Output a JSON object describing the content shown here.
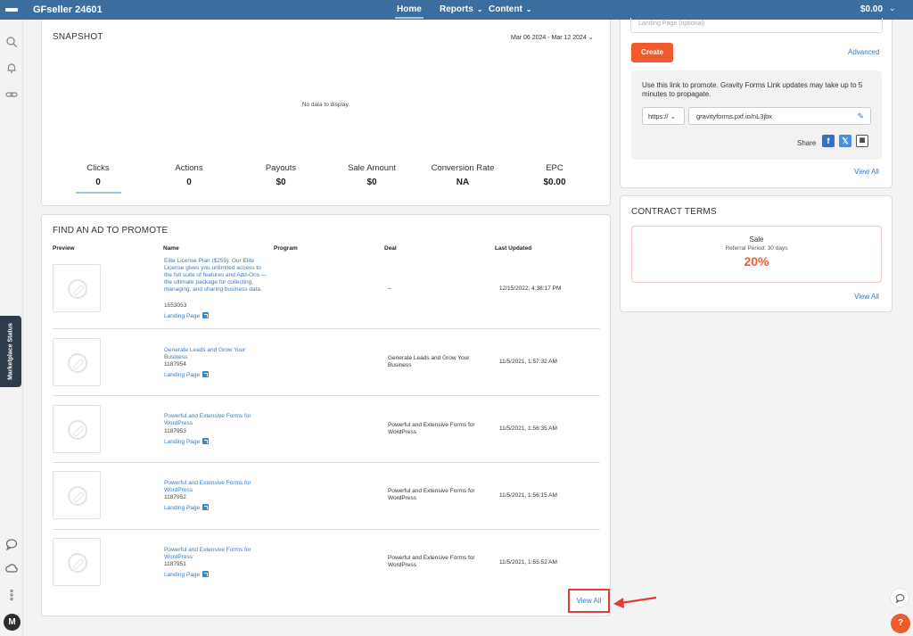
{
  "topbar": {
    "brand": "GFseller 24601",
    "nav": [
      {
        "label": "Home",
        "chev": ""
      },
      {
        "label": "Reports",
        "chev": "⌄"
      },
      {
        "label": "Content",
        "chev": "⌄"
      }
    ],
    "balance": "$0.00"
  },
  "sidebar": {
    "icons": [
      "search-icon",
      "bell-icon",
      "link-icon",
      "chat-icon",
      "cloud-icon",
      "more-icon"
    ],
    "marketplace_tab": "Marketplace Status",
    "avatar_initial": "M"
  },
  "snapshot": {
    "title": "SNAPSHOT",
    "date_range": "Mar 06 2024 - Mar 12 2024",
    "no_data": "No data to display.",
    "stats": [
      {
        "label": "Clicks",
        "value": "0"
      },
      {
        "label": "Actions",
        "value": "0"
      },
      {
        "label": "Payouts",
        "value": "$0"
      },
      {
        "label": "Sale Amount",
        "value": "$0"
      },
      {
        "label": "Conversion Rate",
        "value": "NA"
      },
      {
        "label": "EPC",
        "value": "$0.00"
      }
    ]
  },
  "find_ad": {
    "title": "FIND AN AD TO PROMOTE",
    "columns": [
      "Preview",
      "Name",
      "Program",
      "Deal",
      "Last Updated"
    ],
    "rows": [
      {
        "name": "Elite License Plan ($259): Our Elite License gives you unlimited access to the full suite of features and Add-Ons — the ultimate package for collecting, managing, and sharing business data.",
        "id": "1553053",
        "landing": "Landing Page",
        "deal": "–",
        "updated": "12/15/2022, 4:38:17 PM"
      },
      {
        "name": "Generate Leads and Grow Your Business",
        "id": "1187954",
        "landing": "Landing Page",
        "deal": "Generate Leads and Grow Your Business",
        "updated": "11/5/2021, 1:57:32 AM"
      },
      {
        "name": "Powerful and Extensive Forms for WordPress",
        "id": "1187953",
        "landing": "Landing Page",
        "deal": "Powerful and Extensive Forms for WordPress",
        "updated": "11/5/2021, 1:56:35 AM"
      },
      {
        "name": "Powerful and Extensive Forms for WordPress",
        "id": "1187952",
        "landing": "Landing Page",
        "deal": "Powerful and Extensive Forms for WordPress",
        "updated": "11/5/2021, 1:56:15 AM"
      },
      {
        "name": "Powerful and Extensive Forms for WordPress",
        "id": "1187951",
        "landing": "Landing Page",
        "deal": "Powerful and Extensive Forms for WordPress",
        "updated": "11/5/2021, 1:55:52 AM"
      }
    ],
    "view_all": "View All"
  },
  "link_panel": {
    "landing_placeholder": "Landing Page (optional)",
    "create_label": "Create",
    "advanced_label": "Advanced",
    "promo_text": "Use this link to promote. Gravity Forms Link updates may take up to 5 minutes to propagate.",
    "protocol": "https://",
    "url": "gravityforms.pxf.io/nL3jbx",
    "share_label": "Share",
    "view_all": "View All"
  },
  "contract": {
    "title": "CONTRACT TERMS",
    "type": "Sale",
    "referral_period": "Referral Period: 30 days",
    "percent": "20%",
    "view_all": "View All"
  },
  "colors": {
    "topbar": "#3b6e9e",
    "accent": "#f05a2c",
    "link": "#3a7bc0",
    "highlight_box": "#e23b3b"
  }
}
